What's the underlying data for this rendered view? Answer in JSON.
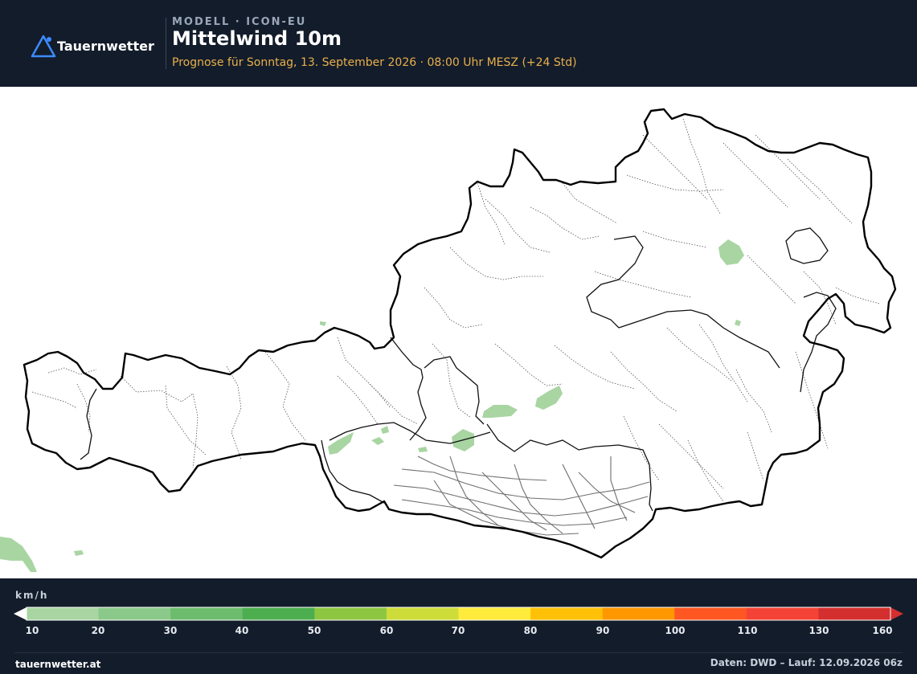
{
  "header": {
    "brand": "Tauernwetter",
    "kicker": "MODELL · ICON-EU",
    "title": "Mittelwind 10m",
    "subtitle": "Prognose für Sonntag, 13. September 2026 · 08:00 Uhr MESZ  (+24 Std)"
  },
  "map": {
    "country": "Austria",
    "wind_areas_color": "#a8d5a2",
    "border_color": "#000000"
  },
  "legend": {
    "unit": "km/h",
    "ticks": [
      "10",
      "20",
      "30",
      "40",
      "50",
      "60",
      "70",
      "80",
      "90",
      "100",
      "110",
      "130",
      "160"
    ],
    "colors": [
      "#a8d5a2",
      "#8ac98a",
      "#6dbc6e",
      "#4cae4f",
      "#8dc641",
      "#cddc39",
      "#ffeb3b",
      "#ffc107",
      "#ff9800",
      "#ff5722",
      "#f44336",
      "#d32f2f"
    ]
  },
  "footer": {
    "site": "tauernwetter.at",
    "source": "Daten: DWD – Lauf: 12.09.2026 06z"
  }
}
